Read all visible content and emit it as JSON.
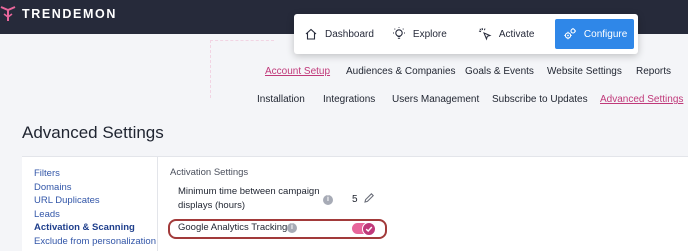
{
  "brand": {
    "name": "TRENDEMON",
    "color": "#e8669b"
  },
  "popup_menu": {
    "items": [
      {
        "label": "Dashboard",
        "icon": "home-icon"
      },
      {
        "label": "Explore",
        "icon": "lightbulb-icon"
      },
      {
        "label": "Activate",
        "icon": "cursor-click-icon"
      },
      {
        "label": "Configure",
        "icon": "gears-icon",
        "active": true
      }
    ]
  },
  "nav_primary": [
    {
      "label": "Account Setup",
      "active": true
    },
    {
      "label": "Audiences & Companies"
    },
    {
      "label": "Goals & Events"
    },
    {
      "label": "Website Settings"
    },
    {
      "label": "Reports"
    }
  ],
  "nav_secondary": [
    {
      "label": "Installation"
    },
    {
      "label": "Integrations"
    },
    {
      "label": "Users Management"
    },
    {
      "label": "Subscribe to Updates"
    },
    {
      "label": "Advanced Settings",
      "active": true
    }
  ],
  "page_title": "Advanced Settings",
  "side_nav": [
    {
      "label": "Filters"
    },
    {
      "label": "Domains"
    },
    {
      "label": "URL Duplicates"
    },
    {
      "label": "Leads"
    },
    {
      "label": "Activation & Scanning",
      "active": true
    },
    {
      "label": "Exclude from personalization"
    }
  ],
  "activation_settings": {
    "title": "Activation Settings",
    "min_time": {
      "label": "Minimum time between campaign displays (hours)",
      "value": "5"
    },
    "google_analytics": {
      "label": "Google Analytics Tracking",
      "enabled": true
    }
  },
  "colors": {
    "topbar": "#262a3a",
    "accent_blue": "#2f87e8",
    "accent_pink": "#c0397a",
    "link_blue": "#3256a8",
    "highlight_box": "#a23a3a"
  }
}
